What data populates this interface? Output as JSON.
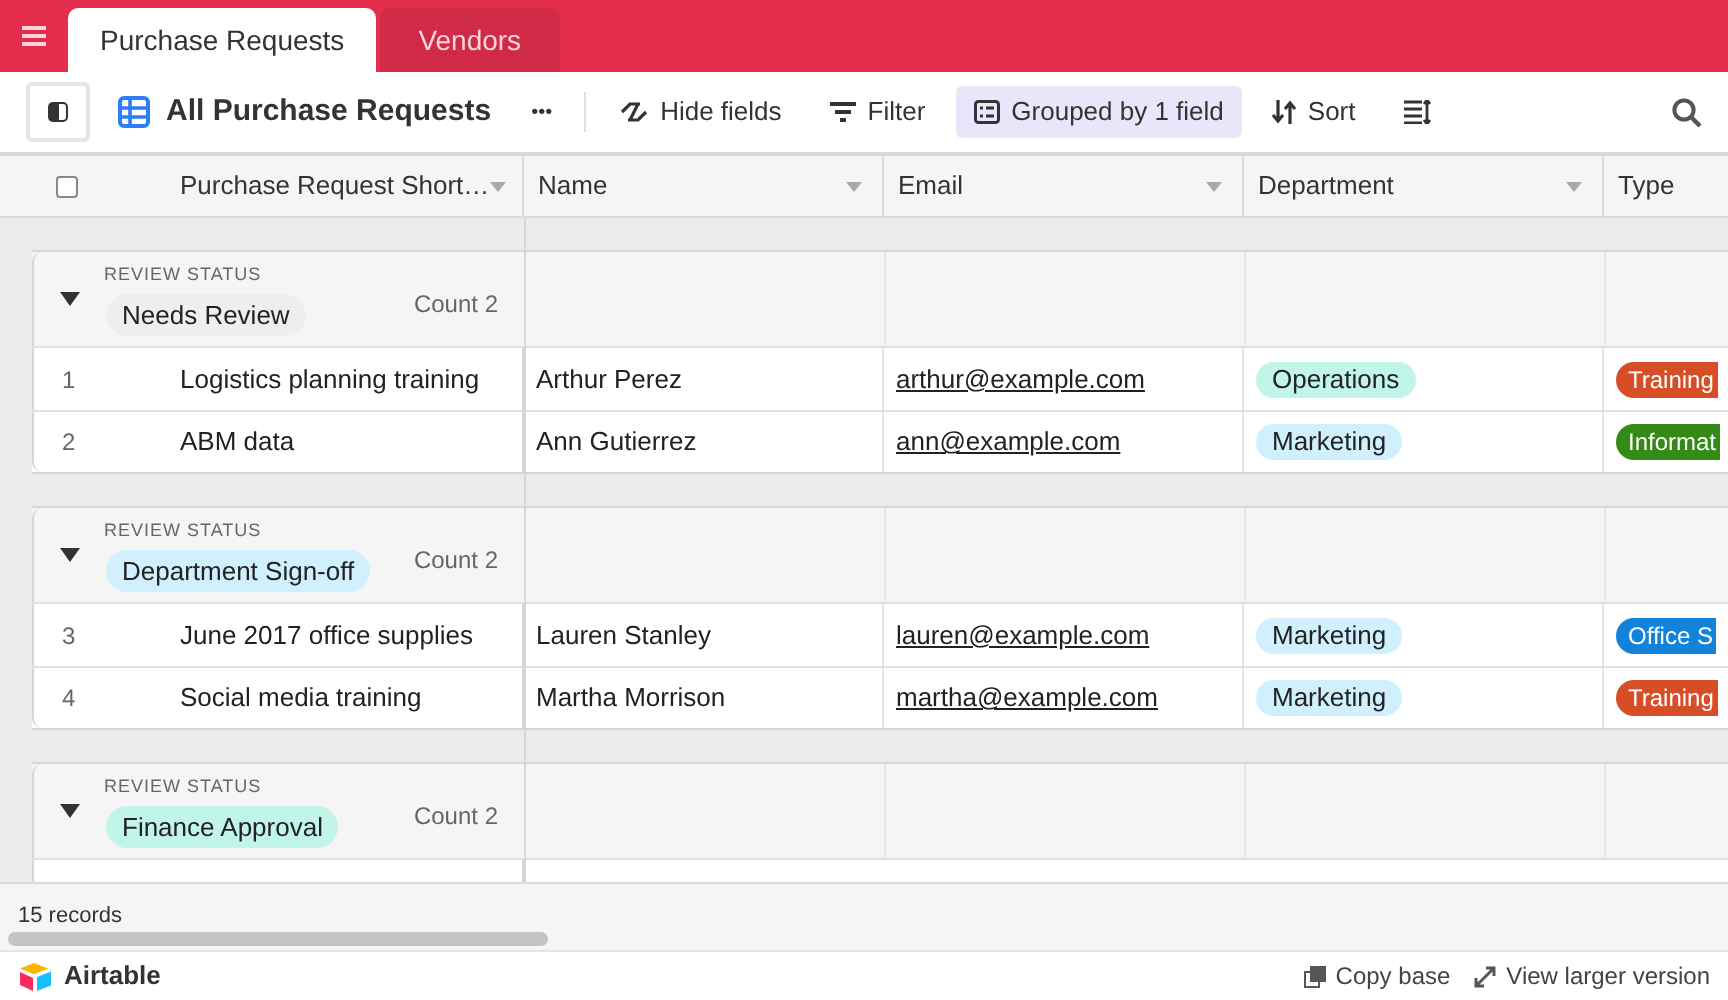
{
  "tabs": [
    {
      "label": "Purchase Requests",
      "selected": true
    },
    {
      "label": "Vendors",
      "selected": false
    }
  ],
  "toolbar": {
    "view_name": "All Purchase Requests",
    "more": "•••",
    "buttons": [
      {
        "kind": "hide",
        "label": "Hide fields",
        "active": false
      },
      {
        "kind": "filter",
        "label": "Filter",
        "active": false
      },
      {
        "kind": "group",
        "label": "Grouped by 1 field",
        "active": true
      },
      {
        "kind": "sort",
        "label": "Sort",
        "active": false
      },
      {
        "kind": "height",
        "active": false
      }
    ]
  },
  "table": {
    "columns": [
      "Purchase Request Short…",
      "Name",
      "Email",
      "Department",
      "Type"
    ],
    "groups": [
      {
        "field": "REVIEW STATUS",
        "value": "Needs Review",
        "color": "#eeeeee",
        "count": "Count 2",
        "expanded": true,
        "rows": [
          {
            "number": "1",
            "title": "Logistics planning training",
            "name": "Arthur Perez",
            "email": "arthur@example.com",
            "department": {
              "label": "Operations",
              "color": "#c2f5e9"
            },
            "type": {
              "label": "Training",
              "color": "#d74d26"
            }
          },
          {
            "number": "2",
            "title": "ABM data",
            "name": "Ann Gutierrez",
            "email": "ann@example.com",
            "department": {
              "label": "Marketing",
              "color": "#d0f0fd"
            },
            "type": {
              "label": "Informat",
              "color": "#338a17"
            }
          }
        ]
      },
      {
        "field": "REVIEW STATUS",
        "value": "Department Sign-off",
        "color": "#d0f0fd",
        "count": "Count 2",
        "expanded": true,
        "rows": [
          {
            "number": "3",
            "title": "June 2017 office supplies",
            "name": "Lauren Stanley",
            "email": "lauren@example.com",
            "department": {
              "label": "Marketing",
              "color": "#d0f0fd"
            },
            "type": {
              "label": "Office S",
              "color": "#1283da"
            }
          },
          {
            "number": "4",
            "title": "Social media training",
            "name": "Martha Morrison",
            "email": "martha@example.com",
            "department": {
              "label": "Marketing",
              "color": "#d0f0fd"
            },
            "type": {
              "label": "Training",
              "color": "#d74d26"
            }
          }
        ]
      },
      {
        "field": "REVIEW STATUS",
        "value": "Finance Approval",
        "color": "#c2f5e9",
        "count": "Count 2",
        "expanded": true
      }
    ],
    "select_all": {
      "checked": false
    }
  },
  "status_bar": {
    "records": "15 records"
  },
  "footer": {
    "brand": "Airtable",
    "links": [
      {
        "kind": "copy",
        "label": "Copy base"
      },
      {
        "kind": "expand",
        "label": "View larger version"
      }
    ]
  }
}
